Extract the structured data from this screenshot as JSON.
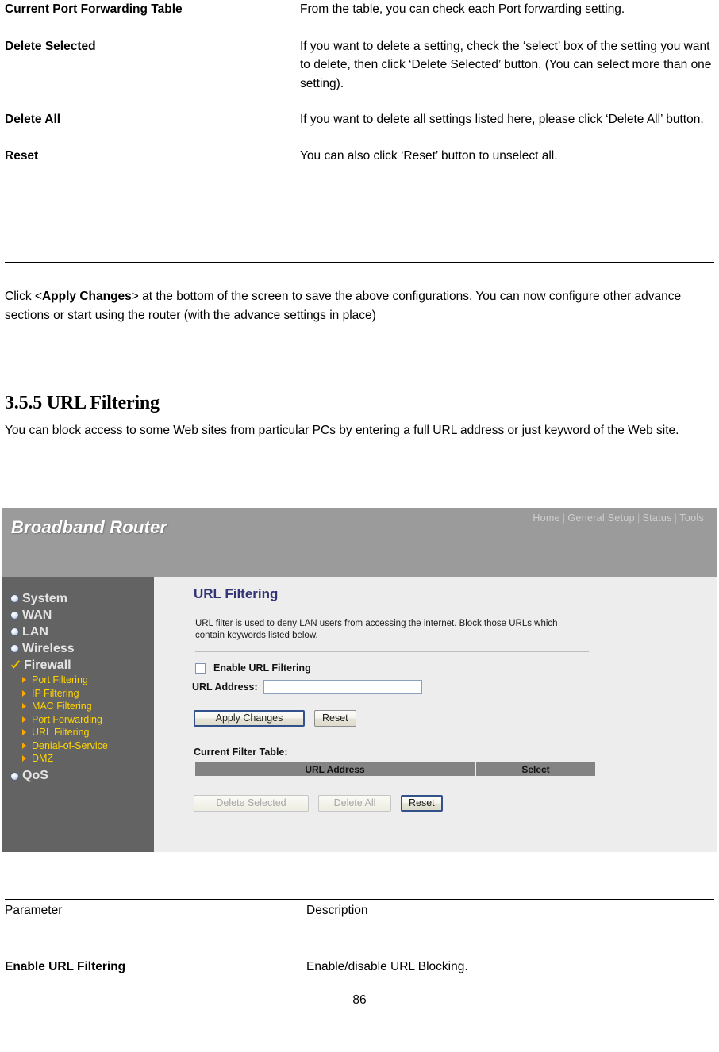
{
  "manual": {
    "parameters_top": [
      {
        "name": "Current Port Forwarding Table",
        "description": "From the table, you can check each Port forwarding setting."
      },
      {
        "name": "Delete Selected",
        "description": "If you want to delete a setting, check the ‘select’ box of the setting you want to delete, then click ‘Delete Selected’ button. (You can select more than one setting)."
      },
      {
        "name": "Delete All",
        "description": "If you want to delete all settings listed here, please click ‘Delete All’ button."
      },
      {
        "name": "Reset",
        "description": "You can also click ‘Reset’ button to unselect all."
      }
    ],
    "apply_paragraph": {
      "lead": "Click <",
      "bold": "Apply Changes",
      "tail": "> at the bottom of the screen to save the above configurations. You can now configure other advance sections or start using the router (with the advance settings in place)"
    },
    "section": {
      "heading": "3.5.5 URL Filtering",
      "body": "You can block access to some Web sites from particular PCs by entering a full URL address or just keyword of the Web site."
    },
    "footer_table": {
      "col_parameter": "Parameter",
      "col_description": "Description",
      "rows": [
        {
          "name": "Enable URL Filtering",
          "description": "Enable/disable URL Blocking."
        }
      ]
    },
    "page_number": "86"
  },
  "screenshot": {
    "brand": "Broadband Router",
    "topnav": [
      {
        "label": "Home"
      },
      {
        "label": "General Setup"
      },
      {
        "label": "Status"
      },
      {
        "label": "Tools"
      }
    ],
    "topnav_separator": "|",
    "sidebar": [
      {
        "label": "System",
        "icon": "bullet-icon",
        "type": "main"
      },
      {
        "label": "WAN",
        "icon": "bullet-icon",
        "type": "main"
      },
      {
        "label": "LAN",
        "icon": "bullet-icon",
        "type": "main"
      },
      {
        "label": "Wireless",
        "icon": "bullet-icon",
        "type": "main"
      },
      {
        "label": "Firewall",
        "icon": "check-icon",
        "type": "main-active"
      },
      {
        "label": "Port Filtering",
        "icon": "arrow-icon",
        "type": "sub"
      },
      {
        "label": "IP Filtering",
        "icon": "arrow-icon",
        "type": "sub"
      },
      {
        "label": "MAC Filtering",
        "icon": "arrow-icon",
        "type": "sub"
      },
      {
        "label": "Port Forwarding",
        "icon": "arrow-icon",
        "type": "sub"
      },
      {
        "label": "URL Filtering",
        "icon": "arrow-icon",
        "type": "sub"
      },
      {
        "label": "Denial-of-Service",
        "icon": "arrow-icon",
        "type": "sub"
      },
      {
        "label": "DMZ",
        "icon": "arrow-icon",
        "type": "sub"
      },
      {
        "label": "QoS",
        "icon": "bullet-icon",
        "type": "main"
      }
    ],
    "panel": {
      "title": "URL Filtering",
      "intro": "URL filter is used to deny LAN users from accessing the internet. Block those URLs which contain keywords listed below.",
      "enable_checkbox_label": "Enable URL Filtering",
      "enable_checkbox_checked": false,
      "url_address_label": "URL Address:",
      "url_address_value": "",
      "apply_button": "Apply Changes",
      "reset_button": "Reset",
      "filter_table_label": "Current Filter Table:",
      "table_headers": [
        "URL Address",
        "Select"
      ],
      "table_rows": [],
      "delete_selected_button": "Delete Selected",
      "delete_all_button": "Delete All",
      "table_reset_button": "Reset"
    },
    "colors": {
      "header_bar": "#9b9b9b",
      "sidebar": "#636363",
      "panel_bg": "#ededed",
      "title": "#333377",
      "sub_link": "#ffd400",
      "table_header": "#838383"
    }
  }
}
